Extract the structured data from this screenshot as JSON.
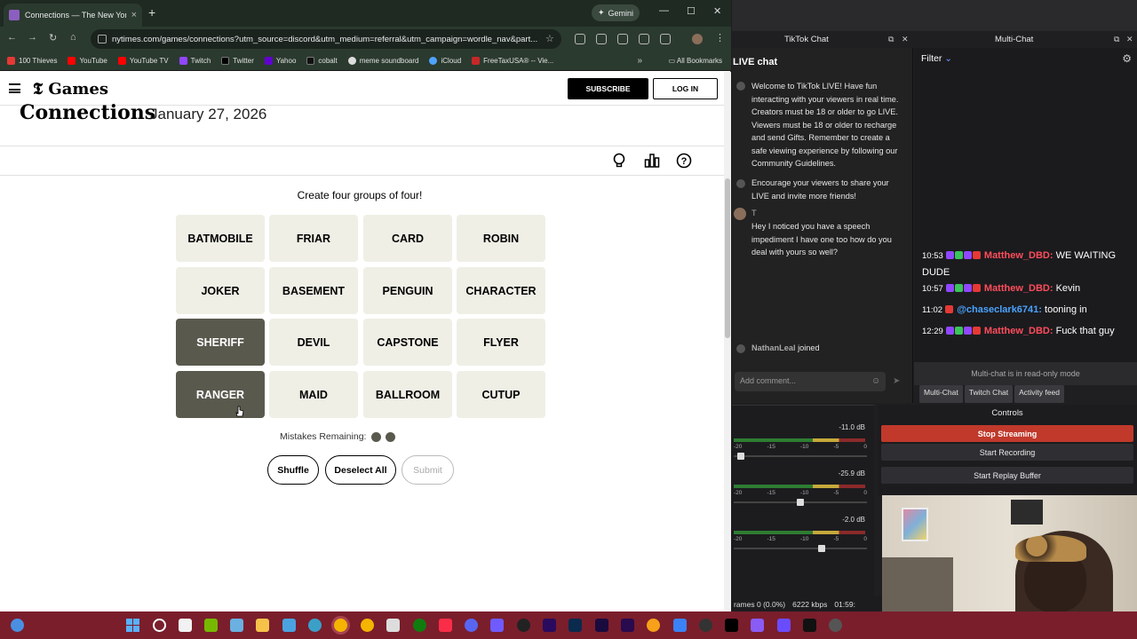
{
  "browser": {
    "tab_title": "Connections — The New York T",
    "tab_close": "×",
    "new_tab": "+",
    "gemini_label": "Gemini",
    "url": "nytimes.com/games/connections?utm_source=discord&utm_medium=referral&utm_campaign=wordle_nav&part...",
    "bookmarks": [
      {
        "label": "100 Thieves",
        "color": "#e53935"
      },
      {
        "label": "YouTube",
        "color": "#ff0000"
      },
      {
        "label": "YouTube TV",
        "color": "#ff0000"
      },
      {
        "label": "Twitch",
        "color": "#9146ff"
      },
      {
        "label": "Twitter",
        "color": "#000000"
      },
      {
        "label": "Yahoo",
        "color": "#6001d2"
      },
      {
        "label": "cobalt",
        "color": "#111111"
      },
      {
        "label": "meme soundboard",
        "color": "#dddddd"
      },
      {
        "label": "iCloud",
        "color": "#4fa3ff"
      },
      {
        "label": "FreeTaxUSA® -- Vie...",
        "color": "#c62828"
      }
    ],
    "bookmarks_more": "»",
    "all_bookmarks": "All Bookmarks"
  },
  "nyt": {
    "logo": "Games",
    "subscribe": "SUBSCRIBE",
    "login": "LOG IN",
    "title": "Connections",
    "date": "January 27, 2026",
    "instruction": "Create four groups of four!",
    "mistakes_label": "Mistakes Remaining:",
    "mistakes_remaining": 2,
    "buttons": {
      "shuffle": "Shuffle",
      "deselect": "Deselect All",
      "submit": "Submit"
    },
    "cards": [
      {
        "word": "BATMOBILE",
        "selected": false
      },
      {
        "word": "FRIAR",
        "selected": false
      },
      {
        "word": "CARD",
        "selected": false
      },
      {
        "word": "ROBIN",
        "selected": false
      },
      {
        "word": "JOKER",
        "selected": false
      },
      {
        "word": "BASEMENT",
        "selected": false
      },
      {
        "word": "PENGUIN",
        "selected": false
      },
      {
        "word": "CHARACTER",
        "selected": false
      },
      {
        "word": "SHERIFF",
        "selected": true
      },
      {
        "word": "DEVIL",
        "selected": false
      },
      {
        "word": "CAPSTONE",
        "selected": false
      },
      {
        "word": "FLYER",
        "selected": false
      },
      {
        "word": "RANGER",
        "selected": true
      },
      {
        "word": "MAID",
        "selected": false
      },
      {
        "word": "BALLROOM",
        "selected": false
      },
      {
        "word": "CUTUP",
        "selected": false
      }
    ]
  },
  "docks": {
    "tiktok_title": "TikTok Chat",
    "multichat_title": "Multi-Chat",
    "controls_title": "Controls"
  },
  "tiktok": {
    "header": "LIVE chat",
    "welcome": "Welcome to TikTok LIVE! Have fun interacting with your viewers in real time. Creators must be 18 or older to go LIVE. Viewers must be 18 or older to recharge and send Gifts. Remember to create a safe viewing experience by following our Community Guidelines.",
    "share": "Encourage your viewers to share your LIVE and invite more friends!",
    "user_initial": "T",
    "user_message": "Hey I noticed you have a speech impediment I have one too how do you deal with yours so well?",
    "join_user": "NathanLeal",
    "join_text": "joined",
    "comment_placeholder": "Add comment..."
  },
  "multichat": {
    "filter": "Filter",
    "messages": [
      {
        "time": "10:53",
        "user": "Matthew_DBD:",
        "text": "WE WAITING DUDE",
        "color": "#ff4d5b"
      },
      {
        "time": "10:57",
        "user": "Matthew_DBD:",
        "text": "Kevin",
        "color": "#ff4d5b"
      },
      {
        "time": "11:02",
        "user": "@chaseclark6741:",
        "text": "tooning in",
        "color": "#4aa3ff"
      },
      {
        "time": "12:29",
        "user": "Matthew_DBD:",
        "text": "Fuck that guy",
        "color": "#ff4d5b"
      }
    ],
    "readonly": "Multi-chat is in read-only mode",
    "tabs": [
      "Multi-Chat",
      "Twitch Chat",
      "Activity feed"
    ]
  },
  "mixer": {
    "channels": [
      {
        "db": "-11.0 dB",
        "level": 0.03
      },
      {
        "db": "-25.9 dB",
        "level": 0.5
      },
      {
        "db": "-2.0 dB",
        "level": 0.67
      }
    ],
    "ticks": [
      "-20",
      "-15",
      "-10",
      "-5",
      "0"
    ]
  },
  "controls": {
    "stop_streaming": "Stop Streaming",
    "start_recording": "Start Recording",
    "start_replay": "Start Replay Buffer"
  },
  "status": {
    "frames": "rames 0 (0.0%)",
    "bitrate": "6222 kbps",
    "time": "01:59:"
  }
}
